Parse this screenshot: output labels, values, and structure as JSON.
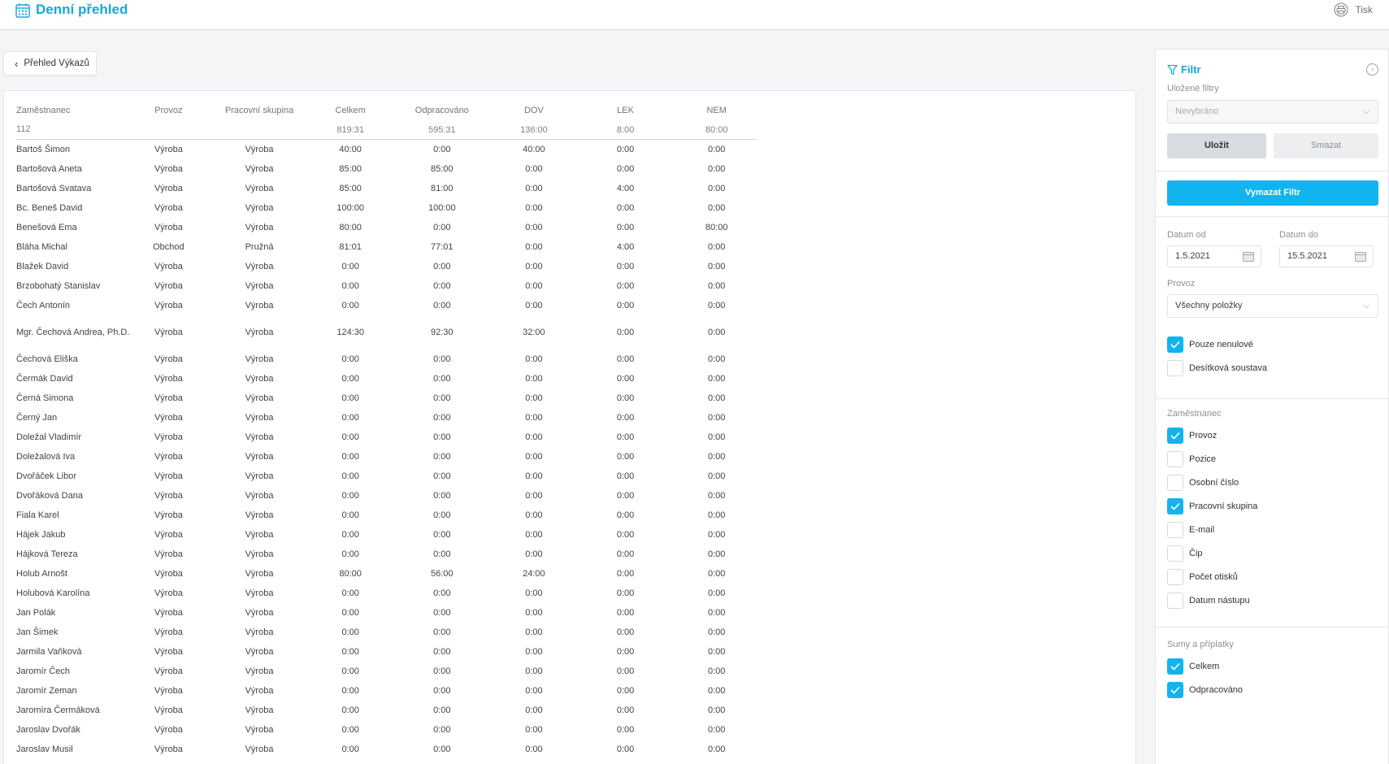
{
  "header": {
    "title": "Denní přehled",
    "print_label": "Tisk"
  },
  "back_button": {
    "label": "Přehled Výkazů"
  },
  "table": {
    "columns": [
      "Zaměstnanec",
      "Provoz",
      "Pracovní skupina",
      "Celkem",
      "Odpracováno",
      "DOV",
      "LEK",
      "NEM"
    ],
    "summary": [
      "112",
      "",
      "",
      "819:31",
      "595:31",
      "136:00",
      "8:00",
      "80:00"
    ],
    "rows": [
      [
        "Bartoš Šimon",
        "Výroba",
        "Výroba",
        "40:00",
        "0:00",
        "40:00",
        "0:00",
        "0:00"
      ],
      [
        "Bartošová Aneta",
        "Výroba",
        "Výroba",
        "85:00",
        "85:00",
        "0:00",
        "0:00",
        "0:00"
      ],
      [
        "Bartošová Svatava",
        "Výroba",
        "Výroba",
        "85:00",
        "81:00",
        "0:00",
        "4:00",
        "0:00"
      ],
      [
        "Bc. Beneš David",
        "Výroba",
        "Výroba",
        "100:00",
        "100:00",
        "0:00",
        "0:00",
        "0:00"
      ],
      [
        "Benešová Ema",
        "Výroba",
        "Výroba",
        "80:00",
        "0:00",
        "0:00",
        "0:00",
        "80:00"
      ],
      [
        "Bláha Michal",
        "Obchod",
        "Pružná",
        "81:01",
        "77:01",
        "0:00",
        "4:00",
        "0:00"
      ],
      [
        "Blažek David",
        "Výroba",
        "Výroba",
        "0:00",
        "0:00",
        "0:00",
        "0:00",
        "0:00"
      ],
      [
        "Brzobohatý Stanislav",
        "Výroba",
        "Výroba",
        "0:00",
        "0:00",
        "0:00",
        "0:00",
        "0:00"
      ],
      [
        "Čech Antonín",
        "Výroba",
        "Výroba",
        "0:00",
        "0:00",
        "0:00",
        "0:00",
        "0:00"
      ],
      [
        "Mgr. Čechová Andrea, Ph.D.",
        "Výroba",
        "Výroba",
        "124:30",
        "92:30",
        "32:00",
        "0:00",
        "0:00"
      ],
      [
        "Čechová Eliška",
        "Výroba",
        "Výroba",
        "0:00",
        "0:00",
        "0:00",
        "0:00",
        "0:00"
      ],
      [
        "Čermák David",
        "Výroba",
        "Výroba",
        "0:00",
        "0:00",
        "0:00",
        "0:00",
        "0:00"
      ],
      [
        "Černá Simona",
        "Výroba",
        "Výroba",
        "0:00",
        "0:00",
        "0:00",
        "0:00",
        "0:00"
      ],
      [
        "Černý Jan",
        "Výroba",
        "Výroba",
        "0:00",
        "0:00",
        "0:00",
        "0:00",
        "0:00"
      ],
      [
        "Doležal Vladimír",
        "Výroba",
        "Výroba",
        "0:00",
        "0:00",
        "0:00",
        "0:00",
        "0:00"
      ],
      [
        "Doležalová Iva",
        "Výroba",
        "Výroba",
        "0:00",
        "0:00",
        "0:00",
        "0:00",
        "0:00"
      ],
      [
        "Dvořáček Libor",
        "Výroba",
        "Výroba",
        "0:00",
        "0:00",
        "0:00",
        "0:00",
        "0:00"
      ],
      [
        "Dvořáková Dana",
        "Výroba",
        "Výroba",
        "0:00",
        "0:00",
        "0:00",
        "0:00",
        "0:00"
      ],
      [
        "Fiala Karel",
        "Výroba",
        "Výroba",
        "0:00",
        "0:00",
        "0:00",
        "0:00",
        "0:00"
      ],
      [
        "Hájek Jakub",
        "Výroba",
        "Výroba",
        "0:00",
        "0:00",
        "0:00",
        "0:00",
        "0:00"
      ],
      [
        "Hájková Tereza",
        "Výroba",
        "Výroba",
        "0:00",
        "0:00",
        "0:00",
        "0:00",
        "0:00"
      ],
      [
        "Holub Arnošt",
        "Výroba",
        "Výroba",
        "80:00",
        "56:00",
        "24:00",
        "0:00",
        "0:00"
      ],
      [
        "Holubová Karolína",
        "Výroba",
        "Výroba",
        "0:00",
        "0:00",
        "0:00",
        "0:00",
        "0:00"
      ],
      [
        "Jan Polák",
        "Výroba",
        "Výroba",
        "0:00",
        "0:00",
        "0:00",
        "0:00",
        "0:00"
      ],
      [
        "Jan Šimek",
        "Výroba",
        "Výroba",
        "0:00",
        "0:00",
        "0:00",
        "0:00",
        "0:00"
      ],
      [
        "Jarmila Vaňková",
        "Výroba",
        "Výroba",
        "0:00",
        "0:00",
        "0:00",
        "0:00",
        "0:00"
      ],
      [
        "Jaromír Čech",
        "Výroba",
        "Výroba",
        "0:00",
        "0:00",
        "0:00",
        "0:00",
        "0:00"
      ],
      [
        "Jaromír Zeman",
        "Výroba",
        "Výroba",
        "0:00",
        "0:00",
        "0:00",
        "0:00",
        "0:00"
      ],
      [
        "Jaromíra Čermáková",
        "Výroba",
        "Výroba",
        "0:00",
        "0:00",
        "0:00",
        "0:00",
        "0:00"
      ],
      [
        "Jaroslav Dvořák",
        "Výroba",
        "Výroba",
        "0:00",
        "0:00",
        "0:00",
        "0:00",
        "0:00"
      ],
      [
        "Jaroslav Musil",
        "Výroba",
        "Výroba",
        "0:00",
        "0:00",
        "0:00",
        "0:00",
        "0:00"
      ]
    ]
  },
  "filter": {
    "title": "Filtr",
    "saved_filters_label": "Uložené filtry",
    "saved_filters_value": "Nevybráno",
    "save_label": "Uložit",
    "delete_label": "Smazat",
    "clear_label": "Vymazat Filtr",
    "date_from_label": "Datum od",
    "date_from_value": "1.5.2021",
    "date_to_label": "Datum do",
    "date_to_value": "15.5.2021",
    "provoz_label": "Provoz",
    "provoz_value": "Všechny položky",
    "options": [
      {
        "label": "Pouze nenulové",
        "checked": true
      },
      {
        "label": "Desítková soustava",
        "checked": false
      }
    ],
    "employee_label": "Zaměstnanec",
    "employee_fields": [
      {
        "label": "Provoz",
        "checked": true
      },
      {
        "label": "Pozice",
        "checked": false
      },
      {
        "label": "Osobní číslo",
        "checked": false
      },
      {
        "label": "Pracovní skupina",
        "checked": true
      },
      {
        "label": "E-mail",
        "checked": false
      },
      {
        "label": "Čip",
        "checked": false
      },
      {
        "label": "Počet otisků",
        "checked": false
      },
      {
        "label": "Datum nástupu",
        "checked": false
      }
    ],
    "sums_label": "Sumy a příplatky",
    "sums": [
      {
        "label": "Celkem",
        "checked": true
      },
      {
        "label": "Odpracováno",
        "checked": true
      }
    ]
  },
  "colors": {
    "accent": "#17a8d8",
    "button_primary": "#12b4ef",
    "background": "#f4f5f7"
  },
  "icons": [
    "calendar-icon",
    "printer-icon",
    "chevron-left-icon",
    "filter-funnel-icon",
    "collapse-circle-icon",
    "chevron-down-icon",
    "checkmark-icon"
  ]
}
